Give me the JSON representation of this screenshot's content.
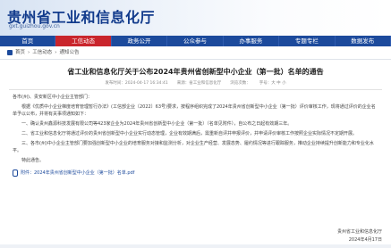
{
  "header": {
    "title": "贵州省工业和信息化厅",
    "url": "gxt.guizhou.gov.cn"
  },
  "nav": {
    "items": [
      {
        "label": "首页",
        "active": false
      },
      {
        "label": "工信动态",
        "active": true
      },
      {
        "label": "政务公开",
        "active": false
      },
      {
        "label": "公众参与",
        "active": false
      },
      {
        "label": "办事服务",
        "active": false
      },
      {
        "label": "专题专栏",
        "active": false
      },
      {
        "label": "数据发布",
        "active": false
      }
    ]
  },
  "breadcrumb": {
    "items": [
      "首页",
      "工信动态",
      "通知公告"
    ]
  },
  "article": {
    "title": "省工业和信息化厅关于公布2024年贵州省创新型中小企业（第一批）名单的通告",
    "date": "发布时间：2024-04-17 16:34:41",
    "source": "来源：省工业和信息化厅",
    "views": "浏览次数：",
    "font_size": "字号：大 中 小",
    "salutation": "各市(州)、贵安新区中小企业主管部门：",
    "paragraphs": [
      "根据《优质中小企业梯度培育管理暂行办法》(工信部企业〔2022〕63号)要求，按程序组织完成了2024年贵州省创新型中小企业（第一批）评价审核工作，现将通过评价的企业名单予以公布，并将有关事项通知如下：",
      "一、确认贵州鑫源科技发展有限公司等423家企业为2024年贵州省创新型中小企业（第一批）（名单见附件），自公布之日起有效期三年。",
      "二、省工业和信息化厅将通过评价的贵州省创新型中小企业实行动态管理，企业有效期满后，需重新自评并申报评价，并申请评价审核工作按照企业实际情况不定期开展。",
      "三、各市(州)中小企业主管部门要加强创新型中小企业的培育服务对接和监测分析，对企业生产经营、发展态势、履约情况等进行跟踪服务，推动企业持续提升创新能力和专业化水平。",
      "特此通告。"
    ],
    "attachment": "附件：2024年贵州省创新型中小企业（第一批）名单.pdf",
    "signature": "贵州省工业和信息化厅",
    "sign_date": "2024年4月17日"
  }
}
